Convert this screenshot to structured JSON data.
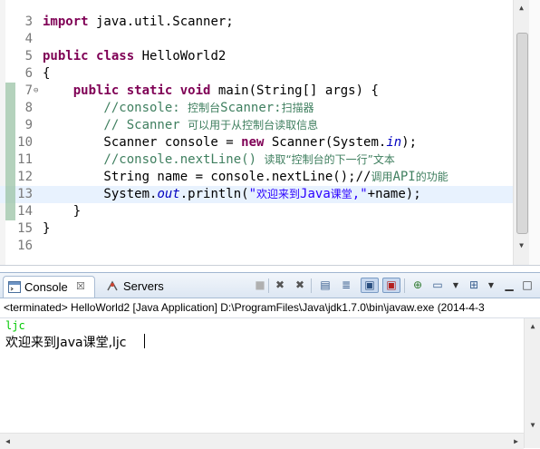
{
  "editor": {
    "lines": [
      {
        "num": "3",
        "segments": [
          {
            "t": "import",
            "c": "kw"
          },
          {
            "t": " java.util.Scanner;",
            "c": ""
          }
        ]
      },
      {
        "num": "4",
        "segments": []
      },
      {
        "num": "5",
        "segments": [
          {
            "t": "public",
            "c": "kw"
          },
          {
            "t": " ",
            "c": ""
          },
          {
            "t": "class",
            "c": "kw"
          },
          {
            "t": " HelloWorld2",
            "c": ""
          }
        ]
      },
      {
        "num": "6",
        "segments": [
          {
            "t": "{",
            "c": ""
          }
        ]
      },
      {
        "num": "7",
        "fold": "⊖",
        "marked": true,
        "segments": [
          {
            "t": "    ",
            "c": ""
          },
          {
            "t": "public",
            "c": "kw"
          },
          {
            "t": " ",
            "c": ""
          },
          {
            "t": "static",
            "c": "kw"
          },
          {
            "t": " ",
            "c": ""
          },
          {
            "t": "void",
            "c": "kw"
          },
          {
            "t": " main(String[] args) {",
            "c": ""
          }
        ]
      },
      {
        "num": "8",
        "marked": true,
        "segments": [
          {
            "t": "        //console: ",
            "c": "cm"
          },
          {
            "t": "控制台",
            "c": "cm cjk"
          },
          {
            "t": "Scanner:",
            "c": "cm"
          },
          {
            "t": "扫描器",
            "c": "cm cjk"
          }
        ]
      },
      {
        "num": "9",
        "marked": true,
        "segments": [
          {
            "t": "        // Scanner ",
            "c": "cm"
          },
          {
            "t": "可以用于从控制台读取信息",
            "c": "cm cjk"
          }
        ]
      },
      {
        "num": "10",
        "marked": true,
        "segments": [
          {
            "t": "        Scanner console = ",
            "c": ""
          },
          {
            "t": "new",
            "c": "kw"
          },
          {
            "t": " Scanner(System.",
            "c": ""
          },
          {
            "t": "in",
            "c": "fld"
          },
          {
            "t": ");",
            "c": ""
          }
        ]
      },
      {
        "num": "11",
        "marked": true,
        "segments": [
          {
            "t": "        //console.nextLine() ",
            "c": "cm"
          },
          {
            "t": "读取“控制台的下一行”文本",
            "c": "cm cjk"
          }
        ]
      },
      {
        "num": "12",
        "marked": true,
        "segments": [
          {
            "t": "        String name = console.nextLine();//",
            "c": ""
          },
          {
            "t": "调用",
            "c": "cm cjk"
          },
          {
            "t": "API",
            "c": "cm"
          },
          {
            "t": "的功能",
            "c": "cm cjk"
          }
        ]
      },
      {
        "num": "13",
        "marked": true,
        "current": true,
        "segments": [
          {
            "t": "        System.",
            "c": ""
          },
          {
            "t": "out",
            "c": "fld"
          },
          {
            "t": ".println(",
            "c": ""
          },
          {
            "t": "\"",
            "c": "str"
          },
          {
            "t": "欢迎来到",
            "c": "str cjk"
          },
          {
            "t": "Java",
            "c": "str"
          },
          {
            "t": "课堂",
            "c": "str cjk"
          },
          {
            "t": ",\"",
            "c": "str"
          },
          {
            "t": "+name);",
            "c": ""
          }
        ]
      },
      {
        "num": "14",
        "marked": true,
        "segments": [
          {
            "t": "    }",
            "c": ""
          }
        ]
      },
      {
        "num": "15",
        "segments": [
          {
            "t": "}",
            "c": ""
          }
        ]
      },
      {
        "num": "16",
        "segments": []
      }
    ]
  },
  "console_view": {
    "tabs": [
      {
        "label": "Console",
        "close": "☒",
        "icon": "console-icon"
      },
      {
        "label": "Servers",
        "icon": "servers-icon"
      }
    ],
    "toolbar_icons": [
      "terminate-icon",
      "remove-launch-icon",
      "remove-all-terminated-icon",
      "clear-console-icon",
      "scroll-lock-icon",
      "show-on-stdout-icon",
      "show-on-stderr-icon",
      "pin-console-icon",
      "display-selected-console-icon",
      "open-console-icon",
      "minimize-icon",
      "maximize-icon"
    ],
    "header": "<terminated> HelloWorld2 [Java Application] D:\\ProgramFiles\\Java\\jdk1.7.0\\bin\\javaw.exe (2014-4-3",
    "input_echo": "ljc",
    "output_line": "欢迎来到Java课堂,ljc"
  }
}
